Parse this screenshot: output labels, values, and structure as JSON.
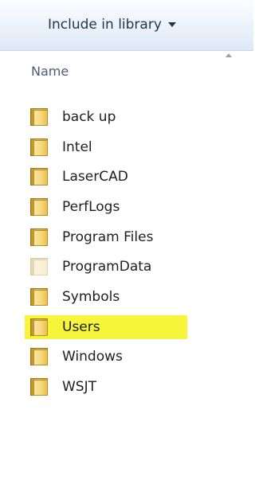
{
  "toolbar": {
    "include_in_library": "Include in library"
  },
  "header": {
    "name_column": "Name"
  },
  "folders": [
    {
      "label": "back up"
    },
    {
      "label": "Intel"
    },
    {
      "label": "LaserCAD"
    },
    {
      "label": "PerfLogs"
    },
    {
      "label": "Program Files"
    },
    {
      "label": "ProgramData"
    },
    {
      "label": "Symbols"
    },
    {
      "label": "Users"
    },
    {
      "label": "Windows"
    },
    {
      "label": "WSJT"
    }
  ],
  "colors": {
    "highlight": "#f6f53a",
    "folder": "#e7c25a"
  },
  "icons": {
    "folder": "folder-icon",
    "dropdown": "chevron-down-icon",
    "sort": "sort-ascending-icon"
  }
}
